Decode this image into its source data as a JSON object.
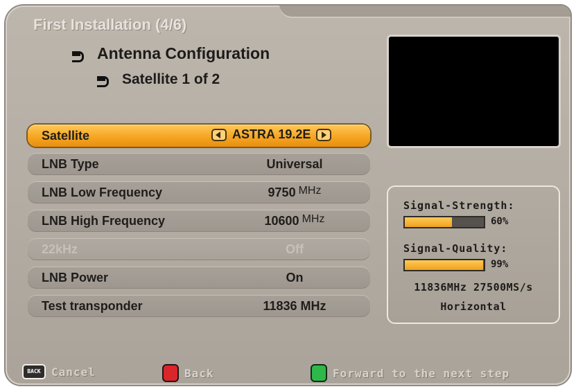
{
  "header": {
    "title": "First Installation (4/6)",
    "breadcrumb_level1": "Antenna Configuration",
    "breadcrumb_level2": "Satellite 1 of 2"
  },
  "menu": [
    {
      "label": "Satellite",
      "value": "ASTRA 19.2E",
      "unit": "",
      "state": "selected"
    },
    {
      "label": "LNB Type",
      "value": "Universal",
      "unit": "",
      "state": "normal"
    },
    {
      "label": "LNB Low Frequency",
      "value": "9750",
      "unit": "MHz",
      "state": "normal"
    },
    {
      "label": "LNB High Frequency",
      "value": "10600",
      "unit": "MHz",
      "state": "normal"
    },
    {
      "label": "22kHz",
      "value": "Off",
      "unit": "",
      "state": "disabled"
    },
    {
      "label": "LNB Power",
      "value": "On",
      "unit": "",
      "state": "normal"
    },
    {
      "label": "Test transponder",
      "value": "11836 MHz",
      "unit": "",
      "state": "normal"
    }
  ],
  "signal": {
    "strength_label": "Signal-Strength:",
    "strength_value": "60%",
    "strength_fraction": 0.6,
    "quality_label": "Signal-Quality:",
    "quality_value": "99%",
    "quality_fraction": 0.99,
    "transponder": "11836MHz 27500MS/s",
    "polarization": "Horizontal"
  },
  "footer": {
    "back_key_text": "BACK",
    "cancel_label": "Cancel",
    "back_label": "Back",
    "forward_label": "Forward to the next step"
  },
  "icons": {
    "breadcrumb": "arrow-right-icon",
    "selector_left": "arrow-left-icon",
    "selector_right": "arrow-right-icon"
  },
  "colors": {
    "highlight": "#f5a623",
    "bar_fill": "#f0a020",
    "red_key": "#d8262a",
    "green_key": "#2fb84a"
  }
}
